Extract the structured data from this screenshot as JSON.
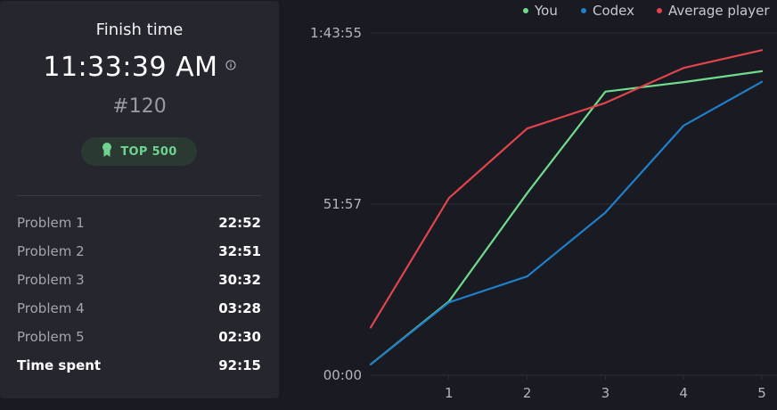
{
  "summary": {
    "finish_label": "Finish time",
    "finish_time": "11:33:39 AM",
    "rank": "#120",
    "badge": "TOP 500",
    "icons": {
      "info": "info-icon",
      "badge": "medal-icon"
    }
  },
  "problems": [
    {
      "name": "Problem 1",
      "time": "22:52"
    },
    {
      "name": "Problem 2",
      "time": "32:51"
    },
    {
      "name": "Problem 3",
      "time": "30:32"
    },
    {
      "name": "Problem 4",
      "time": "03:28"
    },
    {
      "name": "Problem 5",
      "time": "02:30"
    }
  ],
  "total": {
    "name": "Time spent",
    "time": "92:15"
  },
  "chart_data": {
    "type": "line",
    "x": [
      0,
      1,
      2,
      3,
      4,
      5
    ],
    "xticks": [
      "1",
      "2",
      "3",
      "4",
      "5"
    ],
    "yticks": [
      "00:00",
      "51:57",
      "1:43:55"
    ],
    "ylim_minutes": [
      0,
      103.92
    ],
    "grid": true,
    "legend_position": "top-right",
    "series": [
      {
        "name": "You",
        "color": "#6fdc8c",
        "values_minutes": [
          3.3,
          22.4,
          55.3,
          86.1,
          89.0,
          92.3
        ]
      },
      {
        "name": "Codex",
        "color": "#1f7fc8",
        "values_minutes": [
          3.3,
          22.1,
          30.0,
          49.4,
          75.8,
          89.1
        ]
      },
      {
        "name": "Average player",
        "color": "#e0454c",
        "values_minutes": [
          14.5,
          53.8,
          74.9,
          82.7,
          93.3,
          98.7
        ]
      }
    ]
  }
}
